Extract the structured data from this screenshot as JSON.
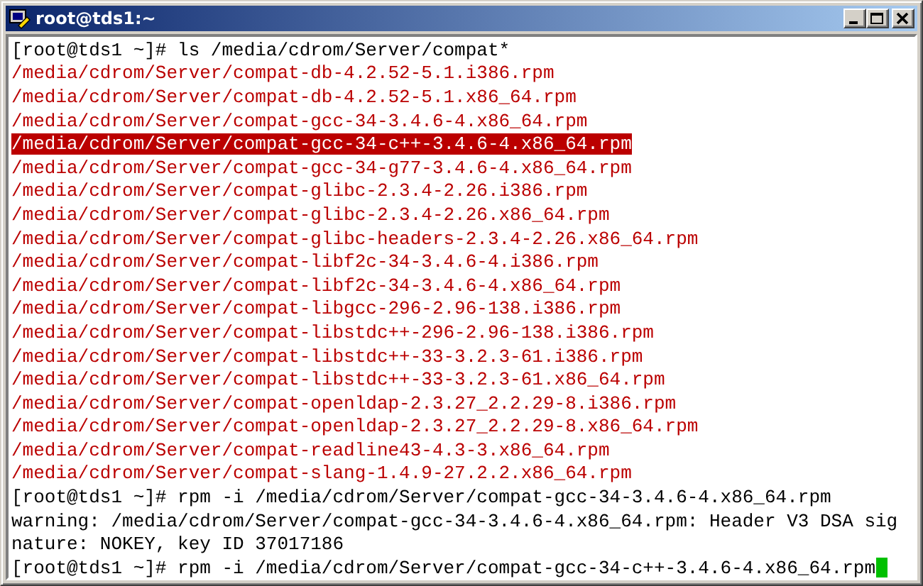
{
  "window": {
    "title": "root@tds1:~"
  },
  "lines": [
    {
      "text": "[root@tds1 ~]# ls /media/cdrom/Server/compat*",
      "kind": "prompt",
      "selected": false,
      "cursor": false
    },
    {
      "text": "/media/cdrom/Server/compat-db-4.2.52-5.1.i386.rpm",
      "kind": "file",
      "selected": false,
      "cursor": false
    },
    {
      "text": "/media/cdrom/Server/compat-db-4.2.52-5.1.x86_64.rpm",
      "kind": "file",
      "selected": false,
      "cursor": false
    },
    {
      "text": "/media/cdrom/Server/compat-gcc-34-3.4.6-4.x86_64.rpm",
      "kind": "file",
      "selected": false,
      "cursor": false
    },
    {
      "text": "/media/cdrom/Server/compat-gcc-34-c++-3.4.6-4.x86_64.rpm",
      "kind": "file",
      "selected": true,
      "cursor": false
    },
    {
      "text": "/media/cdrom/Server/compat-gcc-34-g77-3.4.6-4.x86_64.rpm",
      "kind": "file",
      "selected": false,
      "cursor": false
    },
    {
      "text": "/media/cdrom/Server/compat-glibc-2.3.4-2.26.i386.rpm",
      "kind": "file",
      "selected": false,
      "cursor": false
    },
    {
      "text": "/media/cdrom/Server/compat-glibc-2.3.4-2.26.x86_64.rpm",
      "kind": "file",
      "selected": false,
      "cursor": false
    },
    {
      "text": "/media/cdrom/Server/compat-glibc-headers-2.3.4-2.26.x86_64.rpm",
      "kind": "file",
      "selected": false,
      "cursor": false
    },
    {
      "text": "/media/cdrom/Server/compat-libf2c-34-3.4.6-4.i386.rpm",
      "kind": "file",
      "selected": false,
      "cursor": false
    },
    {
      "text": "/media/cdrom/Server/compat-libf2c-34-3.4.6-4.x86_64.rpm",
      "kind": "file",
      "selected": false,
      "cursor": false
    },
    {
      "text": "/media/cdrom/Server/compat-libgcc-296-2.96-138.i386.rpm",
      "kind": "file",
      "selected": false,
      "cursor": false
    },
    {
      "text": "/media/cdrom/Server/compat-libstdc++-296-2.96-138.i386.rpm",
      "kind": "file",
      "selected": false,
      "cursor": false
    },
    {
      "text": "/media/cdrom/Server/compat-libstdc++-33-3.2.3-61.i386.rpm",
      "kind": "file",
      "selected": false,
      "cursor": false
    },
    {
      "text": "/media/cdrom/Server/compat-libstdc++-33-3.2.3-61.x86_64.rpm",
      "kind": "file",
      "selected": false,
      "cursor": false
    },
    {
      "text": "/media/cdrom/Server/compat-openldap-2.3.27_2.2.29-8.i386.rpm",
      "kind": "file",
      "selected": false,
      "cursor": false
    },
    {
      "text": "/media/cdrom/Server/compat-openldap-2.3.27_2.2.29-8.x86_64.rpm",
      "kind": "file",
      "selected": false,
      "cursor": false
    },
    {
      "text": "/media/cdrom/Server/compat-readline43-4.3-3.x86_64.rpm",
      "kind": "file",
      "selected": false,
      "cursor": false
    },
    {
      "text": "/media/cdrom/Server/compat-slang-1.4.9-27.2.2.x86_64.rpm",
      "kind": "file",
      "selected": false,
      "cursor": false
    },
    {
      "text": "[root@tds1 ~]# rpm -i /media/cdrom/Server/compat-gcc-34-3.4.6-4.x86_64.rpm",
      "kind": "prompt",
      "selected": false,
      "cursor": false
    },
    {
      "text": "warning: /media/cdrom/Server/compat-gcc-34-3.4.6-4.x86_64.rpm: Header V3 DSA sig",
      "kind": "output",
      "selected": false,
      "cursor": false
    },
    {
      "text": "nature: NOKEY, key ID 37017186",
      "kind": "output",
      "selected": false,
      "cursor": false
    },
    {
      "text": "[root@tds1 ~]# rpm -i /media/cdrom/Server/compat-gcc-34-c++-3.4.6-4.x86_64.rpm",
      "kind": "prompt",
      "selected": false,
      "cursor": true
    }
  ]
}
